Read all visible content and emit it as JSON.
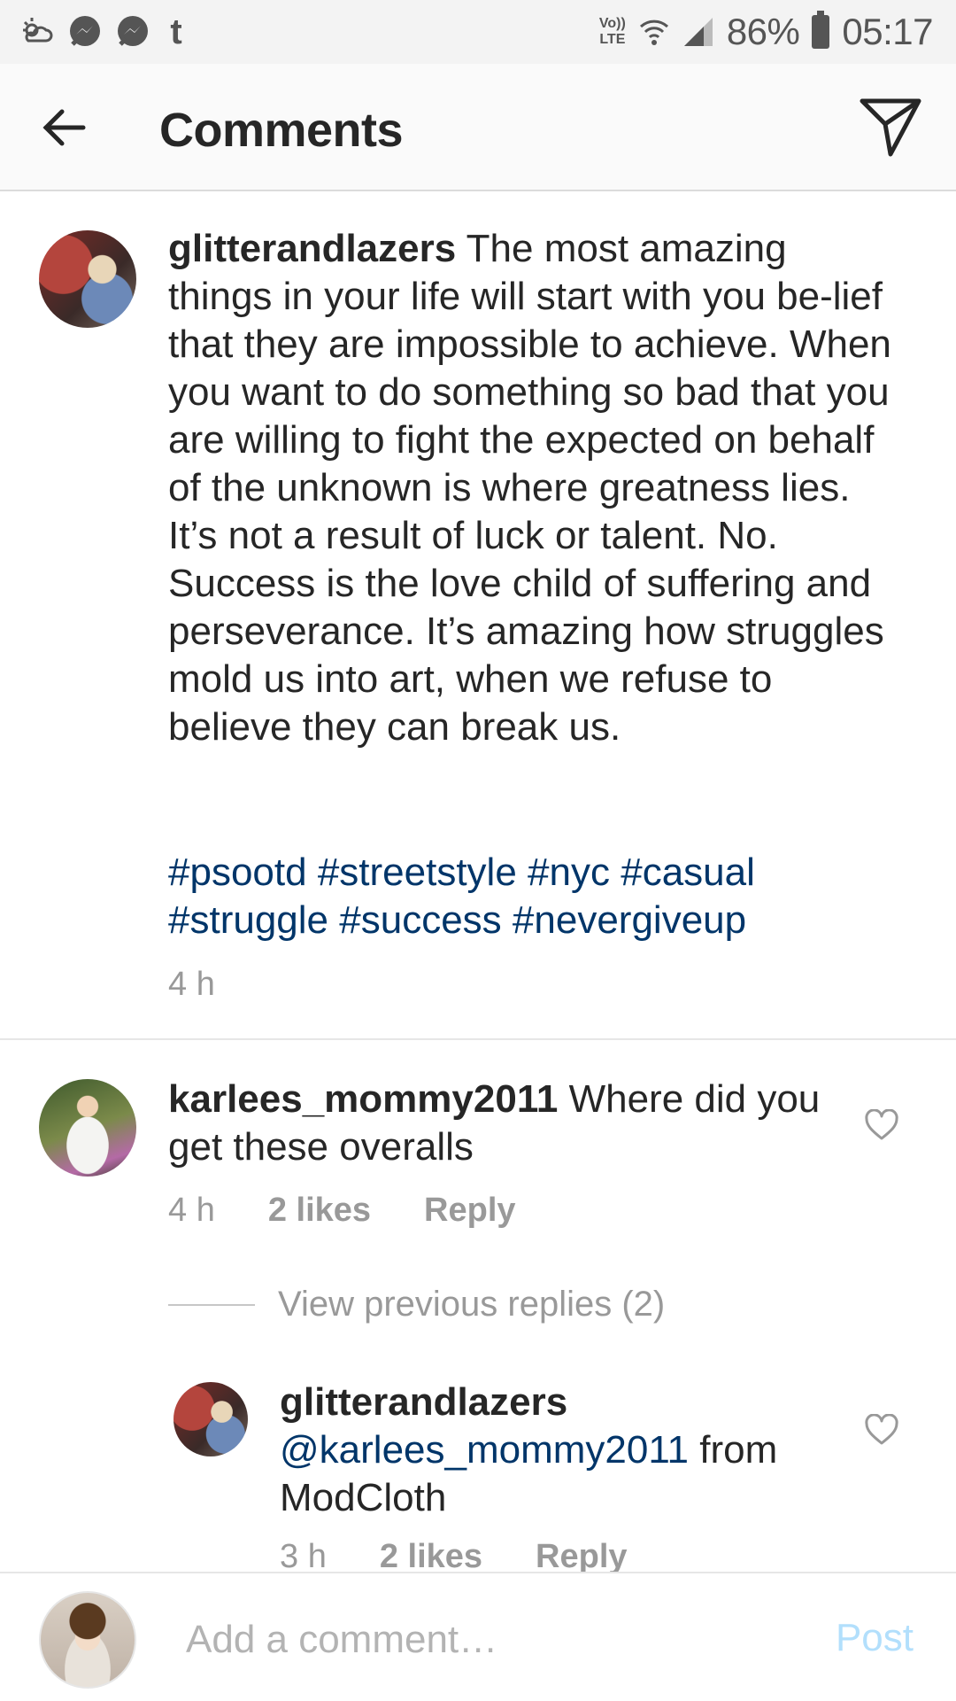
{
  "status_bar": {
    "lte_top": "Vo))",
    "lte_bottom": "LTE",
    "battery": "86%",
    "time": "05:17",
    "icons": [
      "weather-icon",
      "messenger-icon",
      "messenger-icon",
      "tumblr-icon",
      "wifi-icon",
      "signal-icon",
      "battery-icon"
    ]
  },
  "header": {
    "title": "Comments",
    "back_icon": "back-arrow-icon",
    "send_icon": "direct-send-icon"
  },
  "caption": {
    "username": "glitterandlazers",
    "text": "The most amazing things in your life will start with you be-lief that they are impossible to achieve. When you want to do something so bad that you are willing to fight the expected on behalf of the unknown is where greatness lies. It’s not a result of luck or talent. No. Success is the love child of suffering and perseverance. It’s amazing how struggles mold us into art, when we refuse to believe they can break us.",
    "hashtags": [
      "#psootd",
      "#streetstyle",
      "#nyc",
      "#casual",
      "#struggle",
      "#success",
      "#nevergiveup"
    ],
    "time": "4 h"
  },
  "comments": [
    {
      "username": "karlees_mommy2011",
      "text": "Where did you get these overalls",
      "time": "4 h",
      "likes": "2 likes",
      "reply_label": "Reply",
      "view_replies": "View previous replies (2)",
      "replies": [
        {
          "username": "glitterandlazers",
          "mention": "@karlees_mommy2011",
          "text": "from ModCloth",
          "time": "3 h",
          "likes": "2 likes",
          "reply_label": "Reply"
        }
      ]
    }
  ],
  "composer": {
    "placeholder": "Add a comment…",
    "post_label": "Post"
  },
  "colors": {
    "hashtag": "#003569",
    "meta": "#999999",
    "post_disabled": "#b2dffc"
  }
}
